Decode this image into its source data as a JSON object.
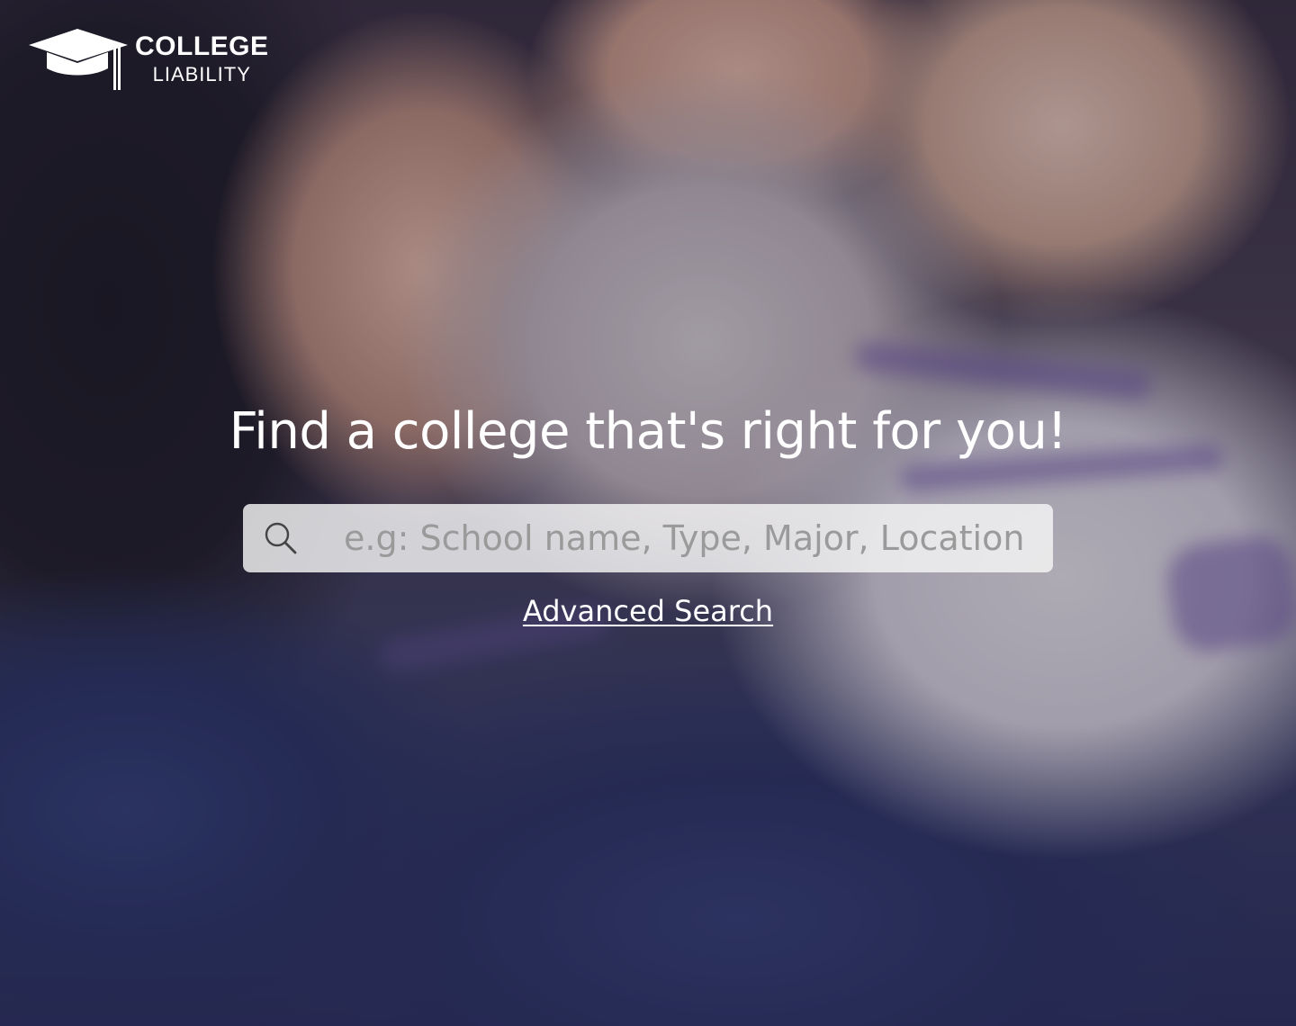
{
  "brand": {
    "title": "COLLEGE",
    "subtitle": "LIABILITY",
    "icon": "graduation-cap-icon"
  },
  "hero": {
    "heading": "Find a college that's right for you!"
  },
  "search": {
    "placeholder": "e.g: School name, Type, Major, Location",
    "value": "",
    "icon": "search-icon"
  },
  "advanced_search": {
    "label": "Advanced Search"
  },
  "colors": {
    "text": "#ffffff",
    "search_background": "#f5f5f5",
    "placeholder": "#9a9a9a"
  }
}
